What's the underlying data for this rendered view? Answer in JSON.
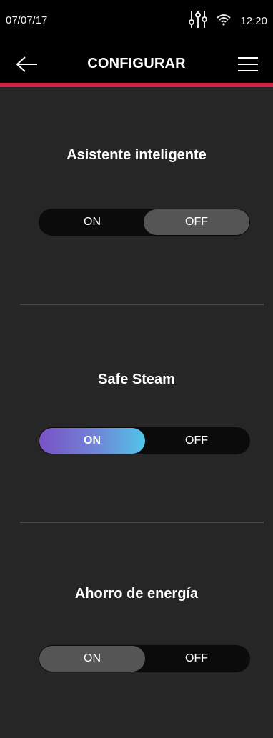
{
  "status_bar": {
    "date": "07/07/17",
    "time": "12:20",
    "icons": [
      "equalizer-icon",
      "wifi-icon"
    ]
  },
  "header": {
    "title": "CONFIGURAR",
    "back_icon": "arrow-left-icon",
    "menu_icon": "hamburger-menu-icon",
    "accent_color": "#d71f45"
  },
  "settings": [
    {
      "title": "Asistente inteligente",
      "on_label": "ON",
      "off_label": "OFF",
      "selected": "OFF"
    },
    {
      "title": "Safe Steam",
      "on_label": "ON",
      "off_label": "OFF",
      "selected": "ON"
    },
    {
      "title": "Ahorro de energía",
      "on_label": "ON",
      "off_label": "OFF",
      "selected": "ON"
    }
  ]
}
